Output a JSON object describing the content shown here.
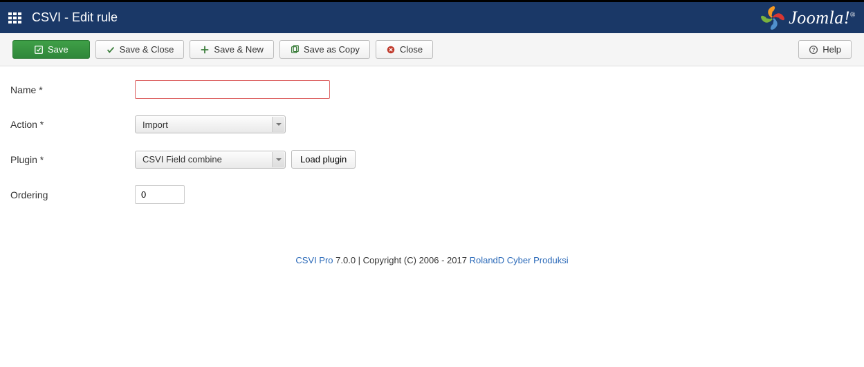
{
  "header": {
    "title": "CSVI - Edit rule",
    "brand": "Joomla!"
  },
  "toolbar": {
    "save": "Save",
    "save_close": "Save & Close",
    "save_new": "Save & New",
    "save_copy": "Save as Copy",
    "close": "Close",
    "help": "Help"
  },
  "form": {
    "name_label": "Name *",
    "name_value": "",
    "action_label": "Action *",
    "action_value": "Import",
    "plugin_label": "Plugin *",
    "plugin_value": "CSVI Field combine",
    "load_plugin": "Load plugin",
    "ordering_label": "Ordering",
    "ordering_value": "0"
  },
  "footer": {
    "link1": "CSVI Pro",
    "mid": " 7.0.0 | Copyright (C) 2006 - 2017 ",
    "link2": "RolandD Cyber Produksi"
  }
}
